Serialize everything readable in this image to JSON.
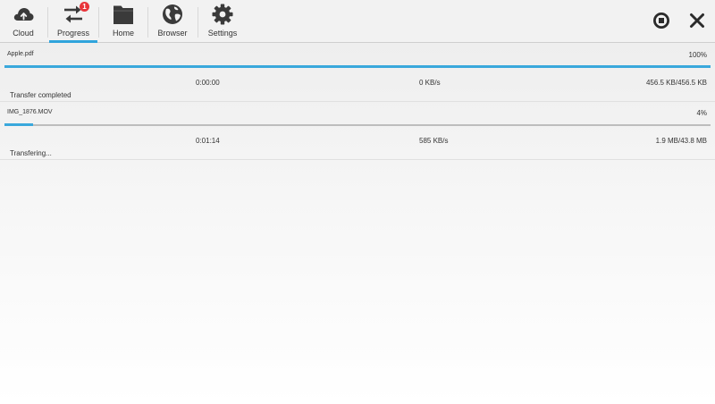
{
  "tabs": [
    {
      "id": "cloud",
      "label": "Cloud",
      "icon": "cloud-icon",
      "active": false
    },
    {
      "id": "progress",
      "label": "Progress",
      "icon": "transfer-arrows-icon",
      "active": true,
      "badge": "1"
    },
    {
      "id": "home",
      "label": "Home",
      "icon": "folder-icon",
      "active": false
    },
    {
      "id": "browser",
      "label": "Browser",
      "icon": "globe-icon",
      "active": false
    },
    {
      "id": "settings",
      "label": "Settings",
      "icon": "gear-icon",
      "active": false
    }
  ],
  "toolbar": {
    "stop_icon": "stop-icon",
    "close_icon": "close-icon"
  },
  "transfers": [
    {
      "name": "Apple.pdf",
      "percent_label": "100%",
      "progress": 1.0,
      "elapsed": "0:00:00",
      "speed": "0 KB/s",
      "size": "456.5 KB/456.5 KB",
      "status": "Transfer completed"
    },
    {
      "name": "IMG_1876.MOV",
      "percent_label": "4%",
      "progress": 0.04,
      "elapsed": "0:01:14",
      "speed": "585 KB/s",
      "size": "1.9 MB/43.8 MB",
      "status": "Transfering..."
    }
  ],
  "colors": {
    "accent": "#2fa4dc",
    "badge": "#e8343a",
    "icon": "#3a3a3a"
  }
}
